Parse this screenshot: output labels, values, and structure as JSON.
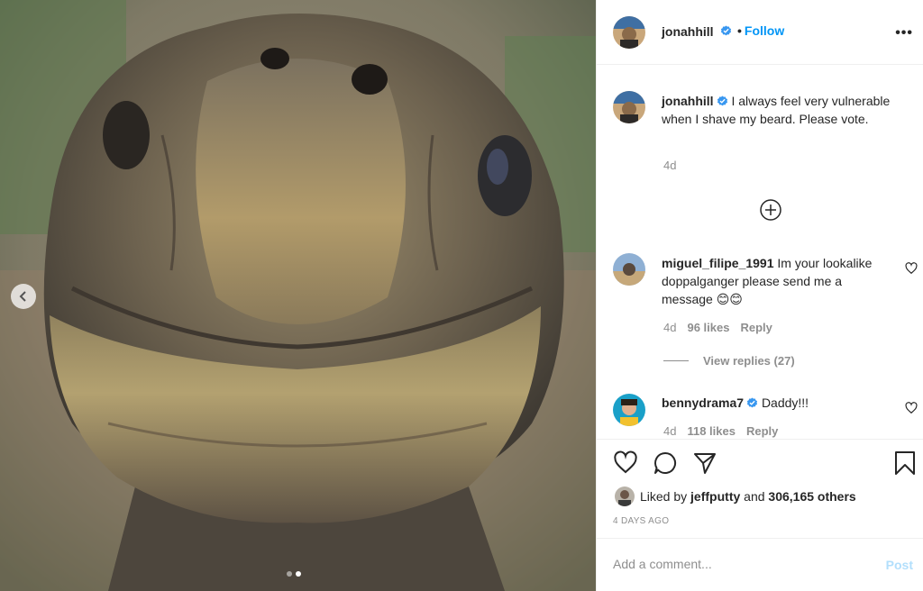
{
  "post": {
    "author": "jonahhill",
    "verified": true,
    "follow_label": "Follow",
    "more_icon": "more-horizontal-icon",
    "caption": "I always feel very vulnerable when I shave my beard. Please vote.",
    "caption_time": "4d",
    "load_more_icon": "plus-circle-icon"
  },
  "comments": [
    {
      "username": "miguel_filipe_1991",
      "verified": false,
      "text": "Im your lookalike doppalganger please send me a message 😊😊",
      "time": "4d",
      "likes": "96 likes",
      "reply_label": "Reply",
      "view_replies": "View replies (27)"
    },
    {
      "username": "bennydrama7",
      "verified": true,
      "text": "Daddy!!!",
      "time": "4d",
      "likes": "118 likes",
      "reply_label": "Reply"
    }
  ],
  "actions": {
    "icons": [
      "heart-icon",
      "comment-icon",
      "share-icon",
      "bookmark-icon"
    ],
    "liked_by_prefix": "Liked by",
    "liked_by_user": "jeffputty",
    "liked_by_and": "and",
    "others_count": "306,165 others",
    "date": "4 DAYS AGO"
  },
  "composer": {
    "placeholder": "Add a comment...",
    "post_label": "Post"
  },
  "carousel": {
    "slide_count": 2,
    "active_index": 1
  },
  "colors": {
    "link_blue": "#0095f6",
    "verified_blue": "#3897f0",
    "muted": "#8e8e8e",
    "post_disabled": "#b2dffc"
  }
}
